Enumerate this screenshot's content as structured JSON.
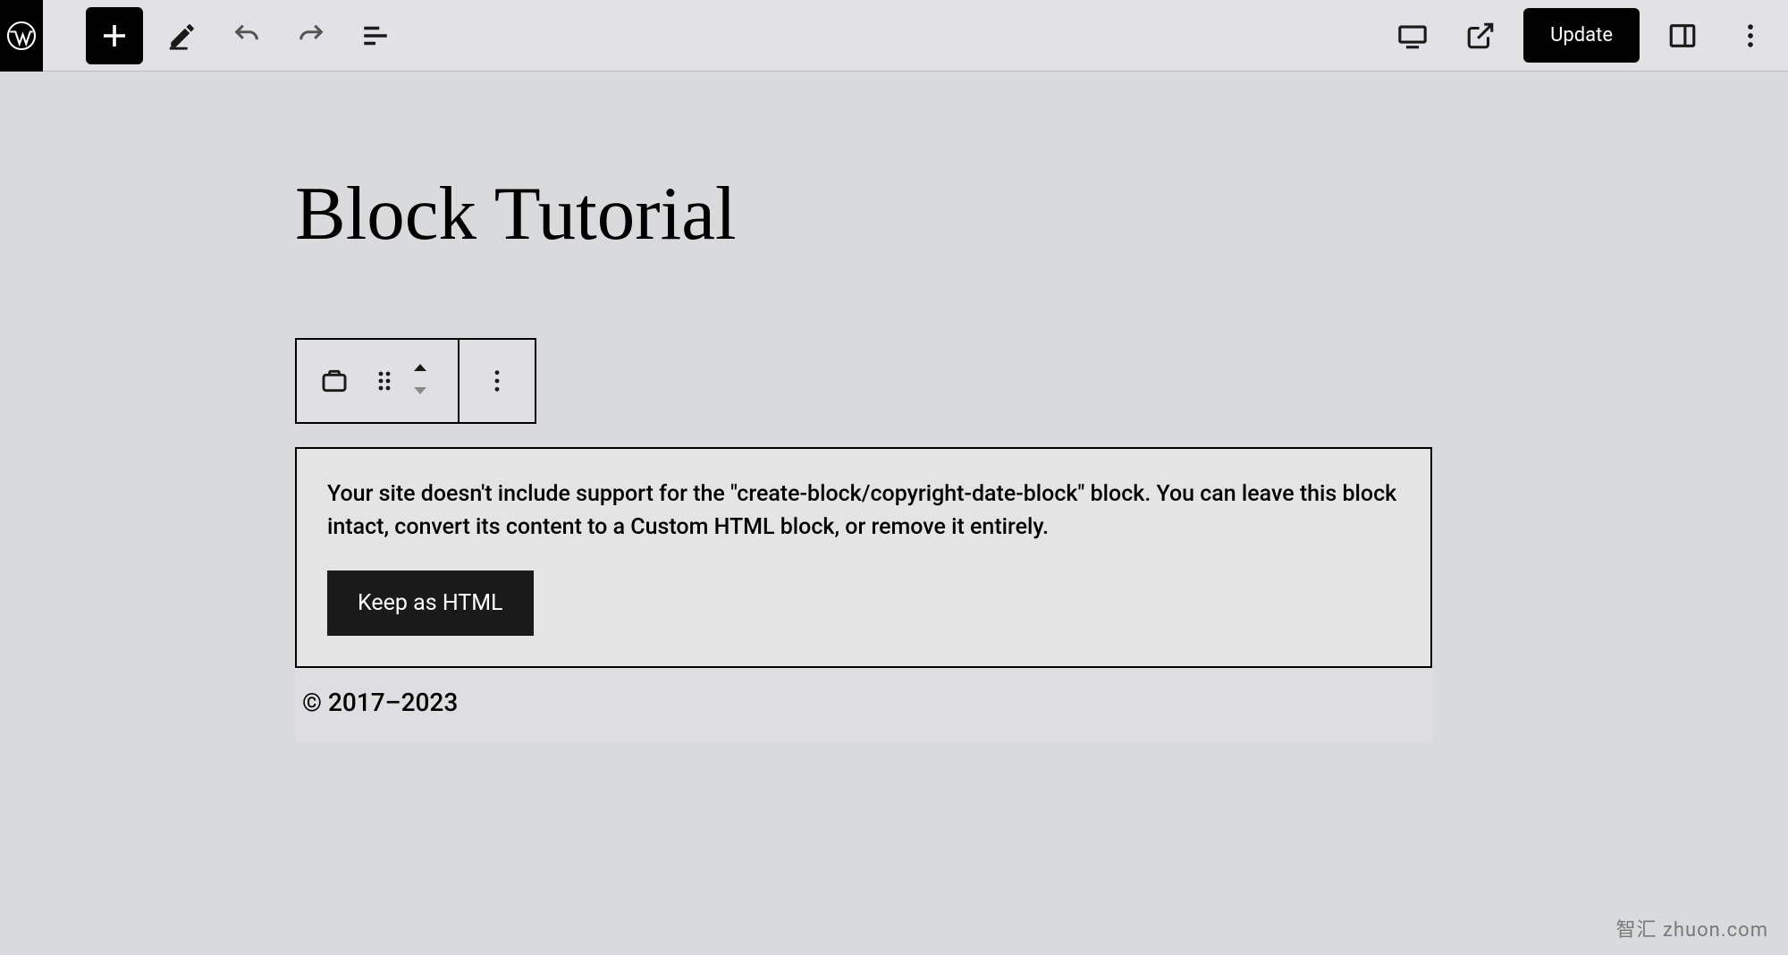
{
  "toolbar": {
    "update_label": "Update"
  },
  "post": {
    "title": "Block Tutorial"
  },
  "block": {
    "warning_text": "Your site doesn't include support for the \"create-block/copyright-date-block\" block. You can leave this block intact, convert its content to a Custom HTML block, or remove it entirely.",
    "keep_html_label": "Keep as HTML",
    "copyright_text": "© 2017–2023"
  },
  "watermark": "智汇 zhuon.com"
}
